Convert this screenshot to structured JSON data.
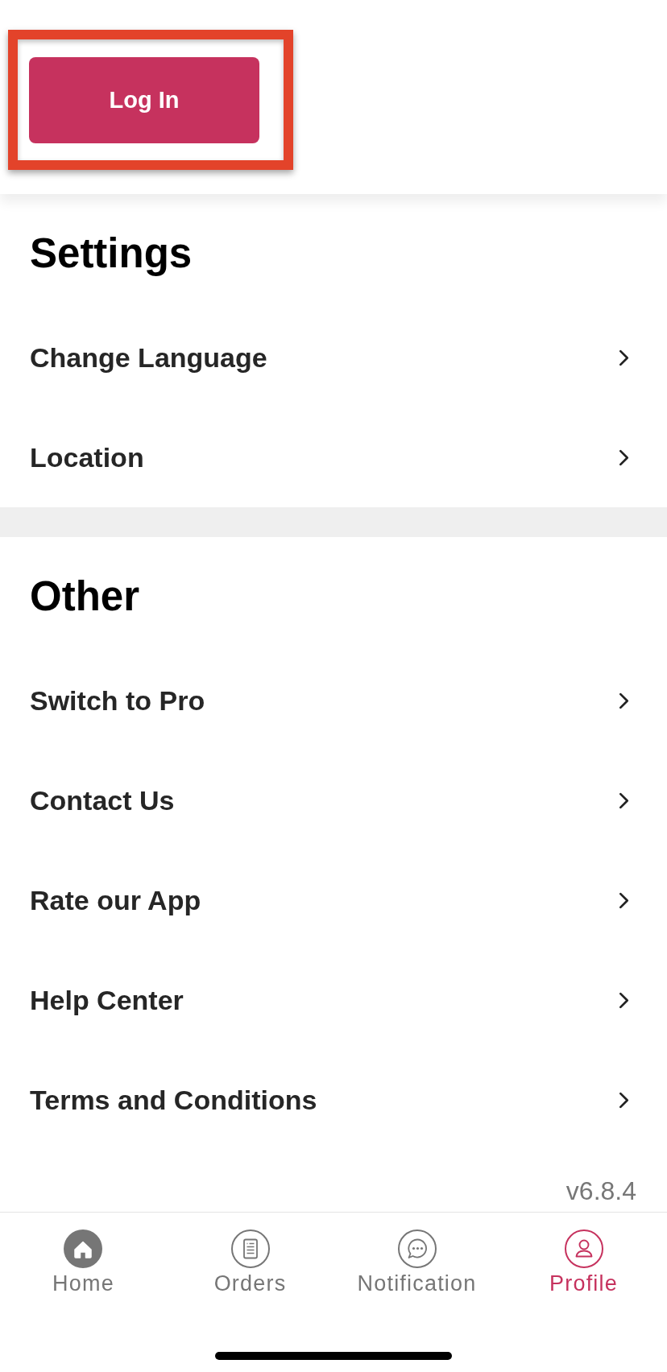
{
  "login": {
    "label": "Log In",
    "highlighted": true
  },
  "sections": [
    {
      "title": "Settings",
      "items": [
        "Change Language",
        "Location"
      ]
    },
    {
      "title": "Other",
      "items": [
        "Switch to Pro",
        "Contact Us",
        "Rate our App",
        "Help Center",
        "Terms and Conditions"
      ]
    }
  ],
  "version": "v6.8.4",
  "nav": [
    {
      "label": "Home",
      "selected": false
    },
    {
      "label": "Orders",
      "selected": false
    },
    {
      "label": "Notification",
      "selected": false
    },
    {
      "label": "Profile",
      "selected": true
    }
  ]
}
